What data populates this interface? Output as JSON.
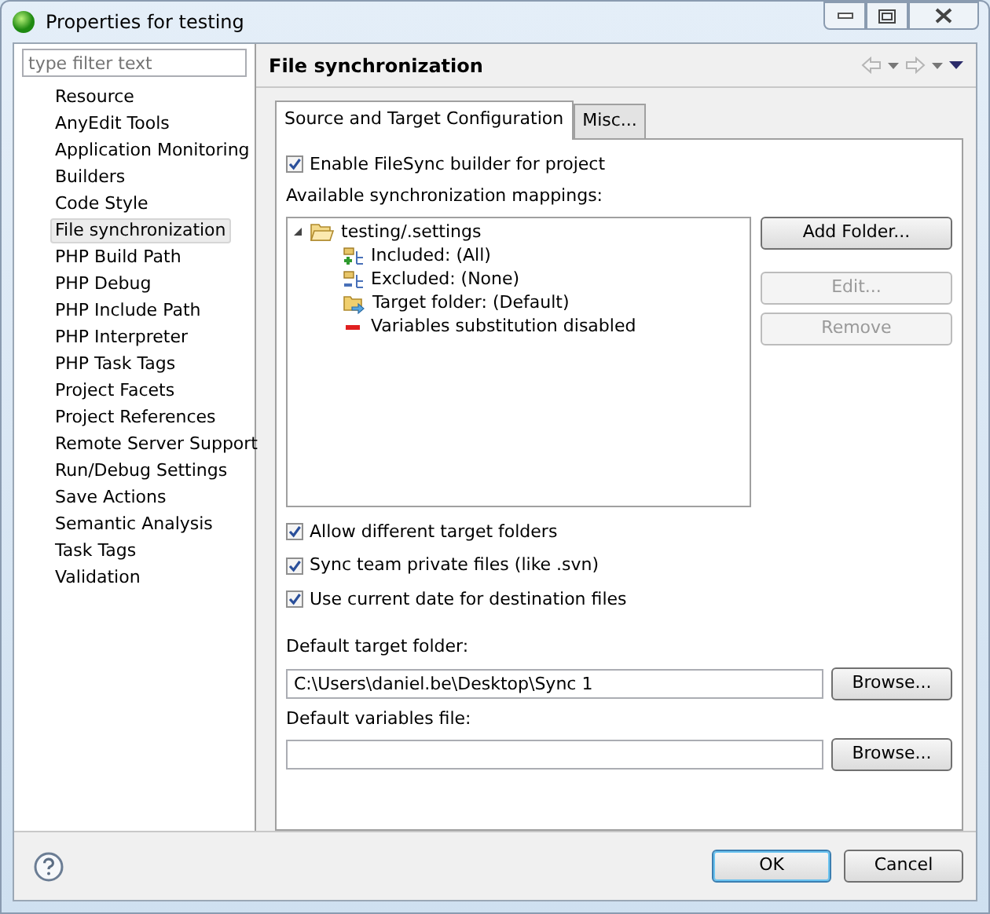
{
  "window": {
    "title": "Properties for testing"
  },
  "filter": {
    "placeholder": "type filter text"
  },
  "sidebar": {
    "items": [
      {
        "label": "Resource",
        "selected": false
      },
      {
        "label": "AnyEdit Tools",
        "selected": false
      },
      {
        "label": "Application Monitoring",
        "selected": false
      },
      {
        "label": "Builders",
        "selected": false
      },
      {
        "label": "Code Style",
        "selected": false
      },
      {
        "label": "File synchronization",
        "selected": true
      },
      {
        "label": "PHP Build Path",
        "selected": false
      },
      {
        "label": "PHP Debug",
        "selected": false
      },
      {
        "label": "PHP Include Path",
        "selected": false
      },
      {
        "label": "PHP Interpreter",
        "selected": false
      },
      {
        "label": "PHP Task Tags",
        "selected": false
      },
      {
        "label": "Project Facets",
        "selected": false
      },
      {
        "label": "Project References",
        "selected": false
      },
      {
        "label": "Remote Server Support",
        "selected": false
      },
      {
        "label": "Run/Debug Settings",
        "selected": false
      },
      {
        "label": "Save Actions",
        "selected": false
      },
      {
        "label": "Semantic Analysis",
        "selected": false
      },
      {
        "label": "Task Tags",
        "selected": false
      },
      {
        "label": "Validation",
        "selected": false
      }
    ]
  },
  "page": {
    "title": "File synchronization"
  },
  "tabs": [
    {
      "label": "Source and Target Configuration",
      "selected": true
    },
    {
      "label": "Misc...",
      "selected": false
    }
  ],
  "enable_builder": {
    "label": "Enable FileSync builder for project",
    "checked": true
  },
  "mappings": {
    "label": "Available synchronization mappings:",
    "tree": [
      {
        "label": "testing/.settings",
        "expanded": true,
        "children": [
          {
            "label": "Included: (All)",
            "kind": "included"
          },
          {
            "label": "Excluded: (None)",
            "kind": "excluded"
          },
          {
            "label": "Target folder: (Default)",
            "kind": "target"
          },
          {
            "label": "Variables substitution disabled",
            "kind": "disabled"
          }
        ]
      }
    ],
    "buttons": [
      {
        "label": "Add Folder...",
        "disabled": false
      },
      {
        "label": "Edit...",
        "disabled": true
      },
      {
        "label": "Remove",
        "disabled": true
      }
    ]
  },
  "options": [
    {
      "label": "Allow different target folders",
      "checked": true
    },
    {
      "label": "Sync team private files (like .svn)",
      "checked": true
    },
    {
      "label": "Use current date for destination files",
      "checked": true
    }
  ],
  "target_folder": {
    "label": "Default target folder:",
    "value": "C:\\Users\\daniel.be\\Desktop\\Sync 1",
    "button": "Browse..."
  },
  "variables_file": {
    "label": "Default variables file:",
    "button": "Browse..."
  },
  "footer": {
    "buttons": [
      {
        "label": "OK",
        "default": true
      },
      {
        "label": "Cancel",
        "default": false
      }
    ]
  }
}
